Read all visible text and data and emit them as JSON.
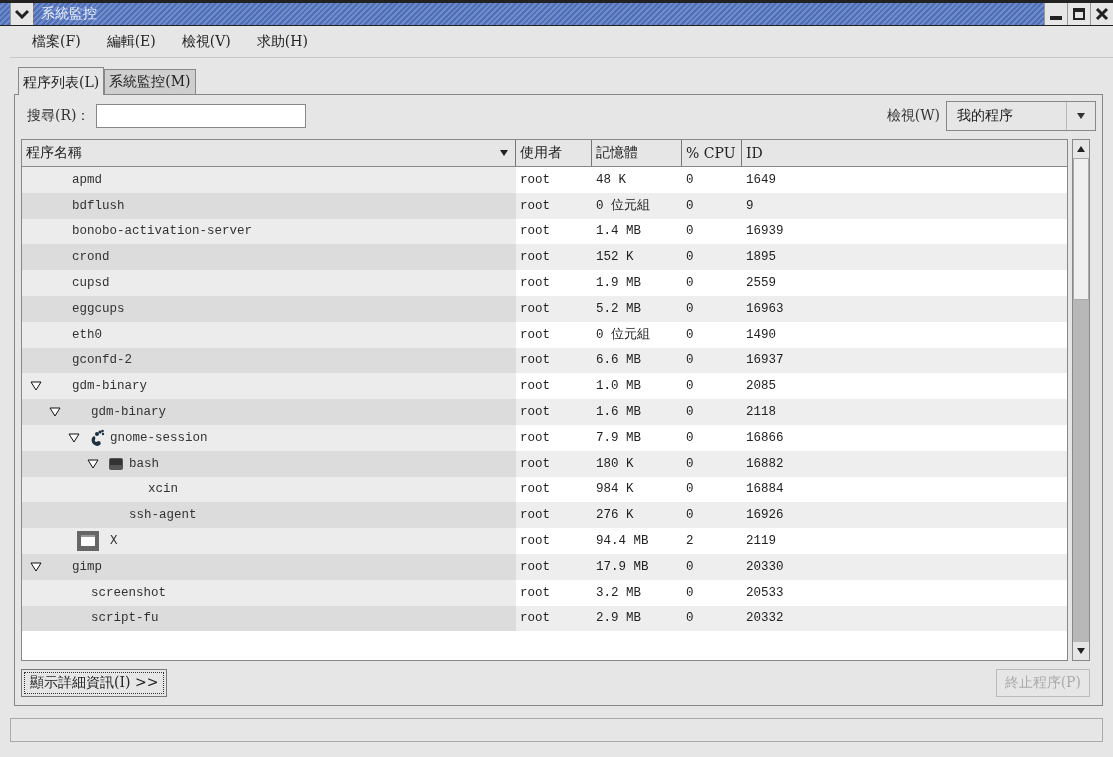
{
  "window": {
    "title": "系統監控"
  },
  "menu": [
    "檔案(F)",
    "編輯(E)",
    "檢視(V)",
    "求助(H)"
  ],
  "tabs": [
    {
      "label": "程序列表(L)",
      "selected": true
    },
    {
      "label": "系統監控(M)",
      "selected": false
    }
  ],
  "search": {
    "label": "搜尋(R)："
  },
  "view_filter": {
    "label": "檢視(W)",
    "value": "我的程序"
  },
  "table": {
    "columns": [
      {
        "label": "程序名稱",
        "sorted": true
      },
      {
        "label": "使用者",
        "sorted": false
      },
      {
        "label": "記憶體",
        "sorted": false
      },
      {
        "label": "% CPU",
        "sorted": false
      },
      {
        "label": "ID",
        "sorted": false
      }
    ],
    "rows": [
      {
        "name": "apmd",
        "user": "root",
        "memory": "48 K",
        "cpu": "0",
        "id": "1649"
      },
      {
        "name": "bdflush",
        "user": "root",
        "memory": "0 位元組",
        "cpu": "0",
        "id": "9"
      },
      {
        "name": "bonobo-activation-server",
        "user": "root",
        "memory": "1.4 MB",
        "cpu": "0",
        "id": "16939"
      },
      {
        "name": "crond",
        "user": "root",
        "memory": "152 K",
        "cpu": "0",
        "id": "1895"
      },
      {
        "name": "cupsd",
        "user": "root",
        "memory": "1.9 MB",
        "cpu": "0",
        "id": "2559"
      },
      {
        "name": "eggcups",
        "user": "root",
        "memory": "5.2 MB",
        "cpu": "0",
        "id": "16963"
      },
      {
        "name": "eth0",
        "user": "root",
        "memory": "0 位元組",
        "cpu": "0",
        "id": "1490"
      },
      {
        "name": "gconfd-2",
        "user": "root",
        "memory": "6.6 MB",
        "cpu": "0",
        "id": "16937"
      },
      {
        "name": "gdm-binary",
        "user": "root",
        "memory": "1.0 MB",
        "cpu": "0",
        "id": "2085",
        "expanded": true,
        "children": [
          {
            "name": "gdm-binary",
            "user": "root",
            "memory": "1.6 MB",
            "cpu": "0",
            "id": "2118",
            "expanded": true,
            "children": [
              {
                "name": "gnome-session",
                "kind": "foot",
                "user": "root",
                "memory": "7.9 MB",
                "cpu": "0",
                "id": "16866",
                "expanded": true,
                "children": [
                  {
                    "name": "bash",
                    "kind": "terminal",
                    "user": "root",
                    "memory": "180 K",
                    "cpu": "0",
                    "id": "16882",
                    "expanded": true,
                    "children": [
                      {
                        "name": "xcin",
                        "user": "root",
                        "memory": "984 K",
                        "cpu": "0",
                        "id": "16884"
                      }
                    ]
                  },
                  {
                    "name": "ssh-agent",
                    "user": "root",
                    "memory": "276 K",
                    "cpu": "0",
                    "id": "16926"
                  }
                ]
              },
              {
                "name": "X",
                "kind": "window",
                "user": "root",
                "memory": "94.4 MB",
                "cpu": "2",
                "id": "2119"
              }
            ]
          }
        ]
      },
      {
        "name": "gimp",
        "user": "root",
        "memory": "17.9 MB",
        "cpu": "0",
        "id": "20330",
        "expanded": true,
        "children": [
          {
            "name": "screenshot",
            "user": "root",
            "memory": "3.2 MB",
            "cpu": "0",
            "id": "20533"
          },
          {
            "name": "script-fu",
            "user": "root",
            "memory": "2.9 MB",
            "cpu": "0",
            "id": "20332"
          }
        ]
      }
    ]
  },
  "buttons": [
    {
      "label": "顯示詳細資訊(I) >>",
      "disabled": false
    },
    {
      "label": "終止程序(P)",
      "disabled": true
    }
  ]
}
